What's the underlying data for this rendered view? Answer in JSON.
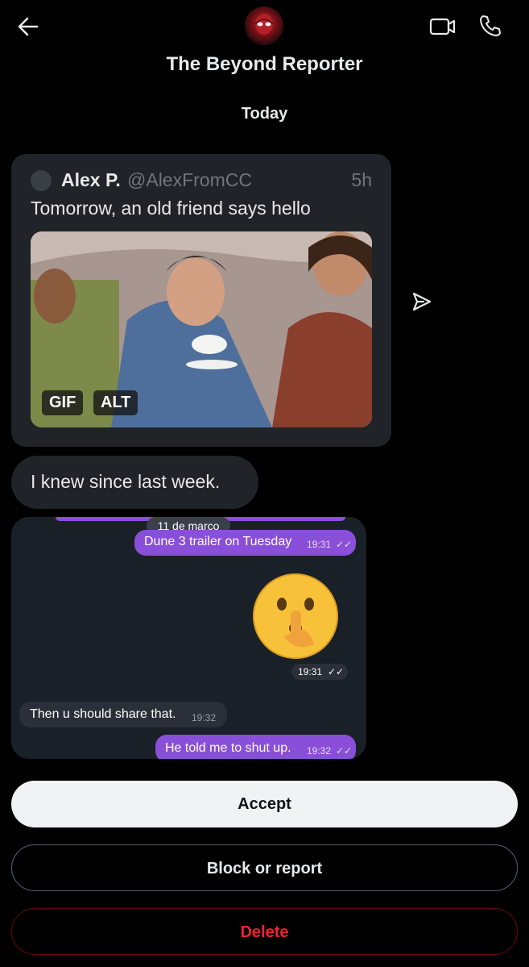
{
  "header": {
    "title": "The Beyond Reporter"
  },
  "icons": {
    "back": "arrow-left-icon",
    "video": "video-camera-icon",
    "call": "phone-icon",
    "share": "share-arrow-icon"
  },
  "conversation": {
    "date_label": "Today",
    "quote": {
      "name": "Alex P.",
      "handle": "@AlexFromCC",
      "time": "5h",
      "text": "Tomorrow, an old friend says hello",
      "badges": [
        "GIF",
        "ALT"
      ]
    },
    "reply": "I knew since last week.",
    "screenshot": {
      "date_chip": "11 de março",
      "messages": [
        {
          "text": "Dune 3 trailer on Tuesday",
          "time": "19:31",
          "side": "out"
        },
        {
          "text": "",
          "time": "19:31",
          "side": "out",
          "emoji": "🤫"
        },
        {
          "text": "Then u should share that.",
          "time": "19:32",
          "side": "in"
        },
        {
          "text": "He told me to shut up.",
          "time": "19:32",
          "side": "out"
        }
      ]
    }
  },
  "actions": {
    "accept": "Accept",
    "block": "Block or report",
    "delete": "Delete"
  },
  "colors": {
    "background": "#000000",
    "card": "#202327",
    "muted": "#71767b",
    "danger": "#f4212e",
    "telegram_out": "#8a4fd8"
  }
}
